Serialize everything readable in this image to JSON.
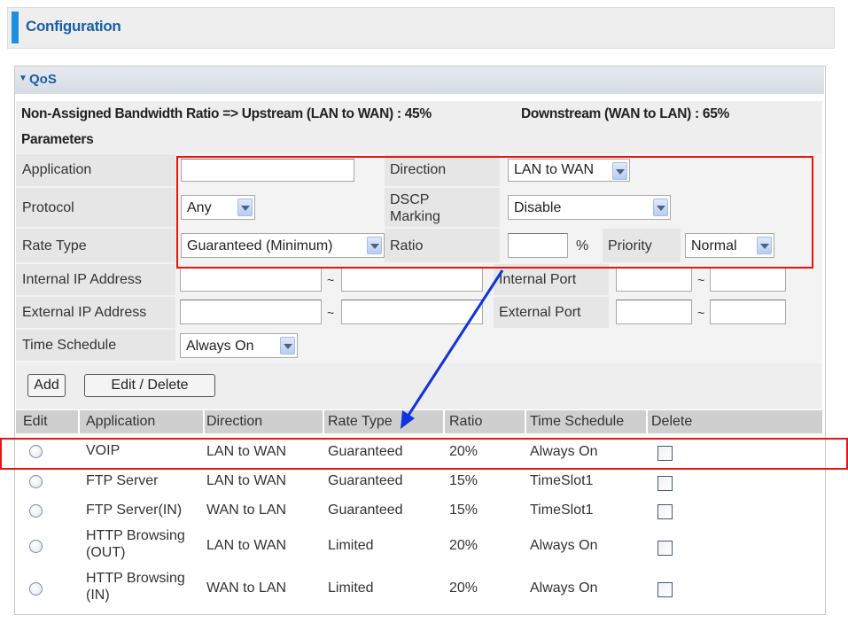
{
  "header": {
    "title": "Configuration"
  },
  "panel": {
    "title": "QoS"
  },
  "bandwidth": {
    "text": "Non-Assigned Bandwidth Ratio => Upstream (LAN to WAN) : 45%",
    "downstream": "Downstream (WAN to LAN) : 65%"
  },
  "params": {
    "title": "Parameters",
    "application_label": "Application",
    "application_value": "",
    "direction_label": "Direction",
    "direction_value": "LAN to WAN",
    "protocol_label": "Protocol",
    "protocol_value": "Any",
    "dscp_label_1": "DSCP",
    "dscp_label_2": "Marking",
    "dscp_value": "Disable",
    "rate_type_label": "Rate Type",
    "rate_type_value": "Guaranteed (Minimum)",
    "ratio_label": "Ratio",
    "ratio_value": "",
    "ratio_unit": "%",
    "priority_label": "Priority",
    "priority_value": "Normal",
    "internal_ip_label": "Internal IP Address",
    "internal_port_label": "Internal Port",
    "external_ip_label": "External IP Address",
    "external_port_label": "External Port",
    "range_sep": "~",
    "time_schedule_label": "Time Schedule",
    "time_schedule_value": "Always On"
  },
  "buttons": {
    "add": "Add",
    "edit_delete": "Edit / Delete"
  },
  "table": {
    "headers": [
      "Edit",
      "Application",
      "Direction",
      "Rate Type",
      "Ratio",
      "Time Schedule",
      "Delete"
    ],
    "rows": [
      {
        "app_1": "VOIP",
        "app_2": "",
        "direction": "LAN to WAN",
        "rate_type": "Guaranteed",
        "ratio": "20%",
        "schedule": "Always On"
      },
      {
        "app_1": "FTP Server",
        "app_2": "",
        "direction": "LAN to WAN",
        "rate_type": "Guaranteed",
        "ratio": "15%",
        "schedule": "TimeSlot1"
      },
      {
        "app_1": "FTP Server(IN)",
        "app_2": "",
        "direction": "WAN to LAN",
        "rate_type": "Guaranteed",
        "ratio": "15%",
        "schedule": "TimeSlot1"
      },
      {
        "app_1": "HTTP Browsing",
        "app_2": "(OUT)",
        "direction": "LAN to WAN",
        "rate_type": "Limited",
        "ratio": "20%",
        "schedule": "Always On"
      },
      {
        "app_1": "HTTP Browsing",
        "app_2": "(IN)",
        "direction": "WAN to LAN",
        "rate_type": "Limited",
        "ratio": "20%",
        "schedule": "Always On"
      }
    ]
  },
  "colors": {
    "accent": "#1c8fe0",
    "title": "#1a5fa8",
    "highlight": "#ee1111",
    "arrow": "#1133dd"
  }
}
